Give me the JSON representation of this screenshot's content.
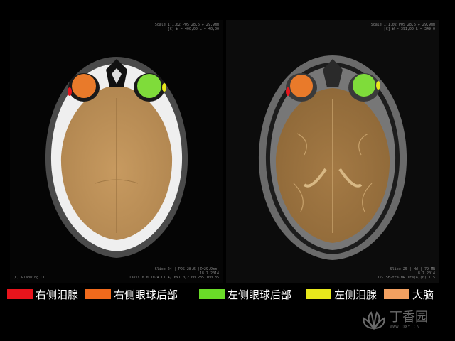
{
  "left_panel": {
    "corner_top_right": [
      "Scale 1:1.02  POS 28,6 ← 29,9mm",
      "[C]  W = 400,00  L = 40,00"
    ],
    "corner_bottom_left": "[C] Planning CT",
    "corner_bottom_right": [
      "Slice 24 | POS 28.6  (Z=29.9mm)",
      "18.7.2014",
      "Taxis  0.0  1024 CT 4/16x1.0/2.00 PBS   100.35"
    ]
  },
  "right_panel": {
    "corner_top_right": [
      "Scale 1:1.02  POS 28,6 ← 29,9mm",
      "[C]  W = 391,00  L = 349,0"
    ],
    "corner_bottom_right": [
      "Slice 25 | Hd | 79 MR",
      "8.7.2014",
      "T2-TSE-tra-MR  Tra(A)(0)   1.5"
    ]
  },
  "legend": [
    {
      "label": "右侧泪腺",
      "color": "#e8141c"
    },
    {
      "label": "右侧眼球后部",
      "color": "#f06a1c"
    },
    {
      "label": "左侧眼球后部",
      "color": "#6adc28"
    },
    {
      "label": "左侧泪腺",
      "color": "#e8e81c"
    },
    {
      "label": "大脑",
      "color": "#f2a060"
    }
  ],
  "watermark": {
    "title": "丁香园",
    "url": "WWW.DXY.CN"
  },
  "colors": {
    "brain_overlay": "#b8894f",
    "skull": "#f2f2f2",
    "right_globe": "#e97a2a",
    "left_globe": "#7fdc3a",
    "right_lacrimal": "#e8141c",
    "left_lacrimal": "#e8e81c"
  }
}
